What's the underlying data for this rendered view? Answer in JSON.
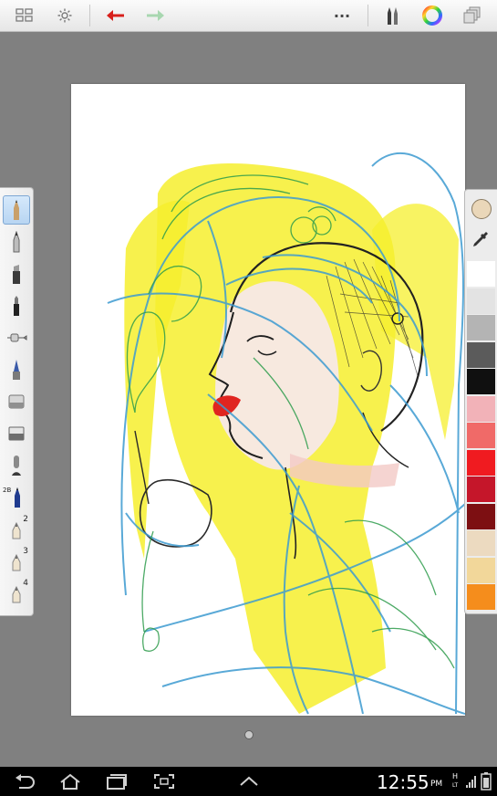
{
  "toolbar": {
    "gallery": "gallery-icon",
    "settings": "gear-icon",
    "undo": "undo-icon",
    "redo": "redo-icon",
    "more": "···",
    "brushes": "brushes-icon",
    "color": "color-wheel-icon",
    "layers": "layers-icon"
  },
  "tools": [
    {
      "name": "pencil",
      "num": ""
    },
    {
      "name": "ballpoint",
      "num": ""
    },
    {
      "name": "marker",
      "num": ""
    },
    {
      "name": "felt-pen",
      "num": ""
    },
    {
      "name": "airbrush",
      "num": ""
    },
    {
      "name": "paintbrush",
      "num": ""
    },
    {
      "name": "soft-eraser",
      "num": ""
    },
    {
      "name": "hard-eraser",
      "num": ""
    },
    {
      "name": "smudge",
      "num": ""
    },
    {
      "name": "2b-pencil",
      "num": "",
      "label": "2B"
    },
    {
      "name": "custom-brush-2",
      "num": "2"
    },
    {
      "name": "custom-brush-3",
      "num": "3"
    },
    {
      "name": "custom-brush-4",
      "num": "4"
    }
  ],
  "colors": {
    "current": "#ead7b9",
    "swatches": [
      "#ffffff",
      "#e3e3e3",
      "#b4b4b4",
      "#5b5b5b",
      "#101010",
      "#f2b2b8",
      "#f06a68",
      "#f01b20",
      "#c5162a",
      "#7d0f12",
      "#ecdac0",
      "#f2d79a",
      "#f58d1c"
    ]
  },
  "pager": "page-indicator",
  "status": {
    "time": "12:55",
    "ampm": "PM",
    "network": "H",
    "network_sub": "LT"
  },
  "navbar": {
    "back": "back-icon",
    "home": "home-icon",
    "recent": "recent-apps-icon",
    "screenshot": "screenshot-icon",
    "up": "chevron-up-icon"
  }
}
